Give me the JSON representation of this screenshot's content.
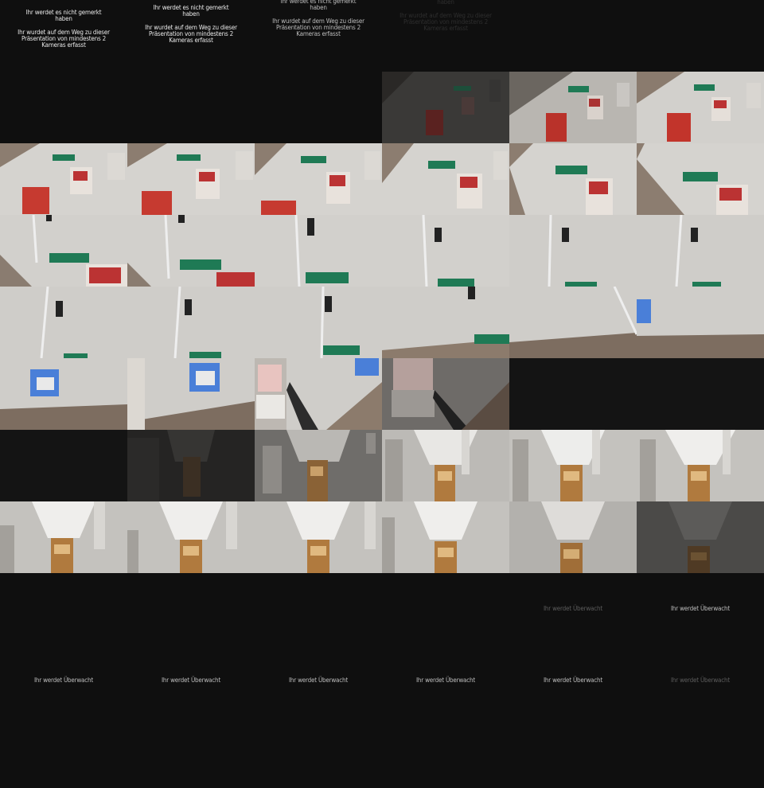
{
  "captions": {
    "line1": "Ihr werdet es nicht gemerkt",
    "line2": "haben",
    "line3": "Ihr wurdet auf dem Weg zu dieser",
    "line4": "Präsentation von mindestens 2",
    "line5": "Kameras erfasst",
    "watched": "Ihr werdet Überwacht"
  },
  "colors": {
    "background": "#0f0f0f",
    "exit_sign": "#1f7a55",
    "poster_red": "#c0392b",
    "character_blue": "#4a7fd8"
  }
}
